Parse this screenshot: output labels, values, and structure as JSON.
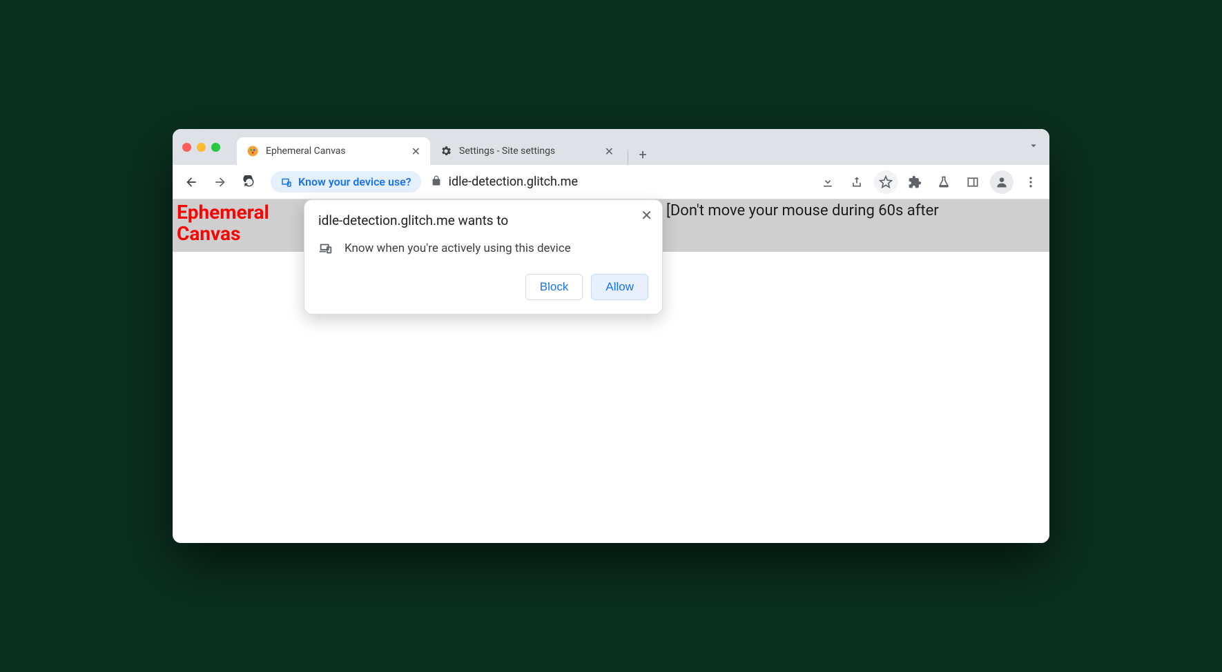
{
  "tabs": [
    {
      "title": "Ephemeral Canvas",
      "active": true
    },
    {
      "title": "Settings - Site settings",
      "active": false
    }
  ],
  "toolbar": {
    "chip_label": "Know your device use?",
    "url": "idle-detection.glitch.me"
  },
  "page": {
    "title": "Ephemeral Canvas",
    "desc": "[Don't move your mouse during 60s after"
  },
  "permission": {
    "title": "idle-detection.glitch.me wants to",
    "item": "Know when you're actively using this device",
    "block": "Block",
    "allow": "Allow"
  }
}
